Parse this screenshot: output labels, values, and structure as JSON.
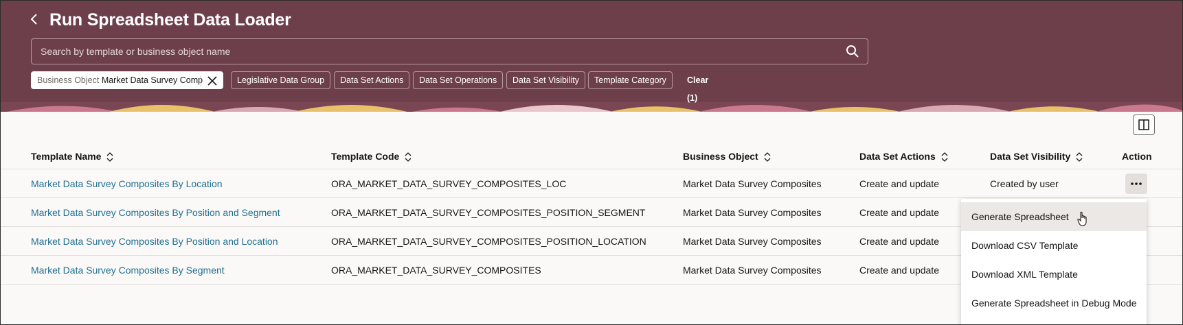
{
  "header": {
    "title": "Run Spreadsheet Data Loader",
    "search": {
      "placeholder": "Search by template or business object name",
      "value": ""
    },
    "active_filter": {
      "key": "Business Object",
      "value": "Market Data Survey Comp"
    },
    "filters": [
      "Legislative Data Group",
      "Data Set Actions",
      "Data Set Operations",
      "Data Set Visibility",
      "Template Category"
    ],
    "clear_label": "Clear (1)"
  },
  "colors": {
    "header_bg": "#6d3f4b",
    "link": "#1e6f8f",
    "page_bg": "#fbf9f8"
  },
  "table": {
    "columns": [
      "Template Name",
      "Template Code",
      "Business Object",
      "Data Set Actions",
      "Data Set Visibility",
      "Action"
    ],
    "rows": [
      {
        "name": "Market Data Survey Composites By Location",
        "code": "ORA_MARKET_DATA_SURVEY_COMPOSITES_LOC",
        "object": "Market Data Survey Composites",
        "actions": "Create and update",
        "visibility": "Created by user"
      },
      {
        "name": "Market Data Survey Composites By Position and Segment",
        "code": "ORA_MARKET_DATA_SURVEY_COMPOSITES_POSITION_SEGMENT",
        "object": "Market Data Survey Composites",
        "actions": "Create and update",
        "visibility": ""
      },
      {
        "name": "Market Data Survey Composites By Position and Location",
        "code": "ORA_MARKET_DATA_SURVEY_COMPOSITES_POSITION_LOCATION",
        "object": "Market Data Survey Composites",
        "actions": "Create and update",
        "visibility": ""
      },
      {
        "name": "Market Data Survey Composites By Segment",
        "code": "ORA_MARKET_DATA_SURVEY_COMPOSITES",
        "object": "Market Data Survey Composites",
        "actions": "Create and update",
        "visibility": ""
      }
    ]
  },
  "action_menu": {
    "items": [
      "Generate Spreadsheet",
      "Download CSV Template",
      "Download XML Template",
      "Generate Spreadsheet in Debug Mode"
    ],
    "hovered_item": "Generate Spreadsheet"
  },
  "icons": {
    "back": "chevron-left-icon",
    "search": "search-icon",
    "remove_filter": "close-icon",
    "columns": "columns-icon",
    "sort": "sort-icon",
    "more": "more-horizontal-icon",
    "cursor": "hand-pointer-icon"
  }
}
